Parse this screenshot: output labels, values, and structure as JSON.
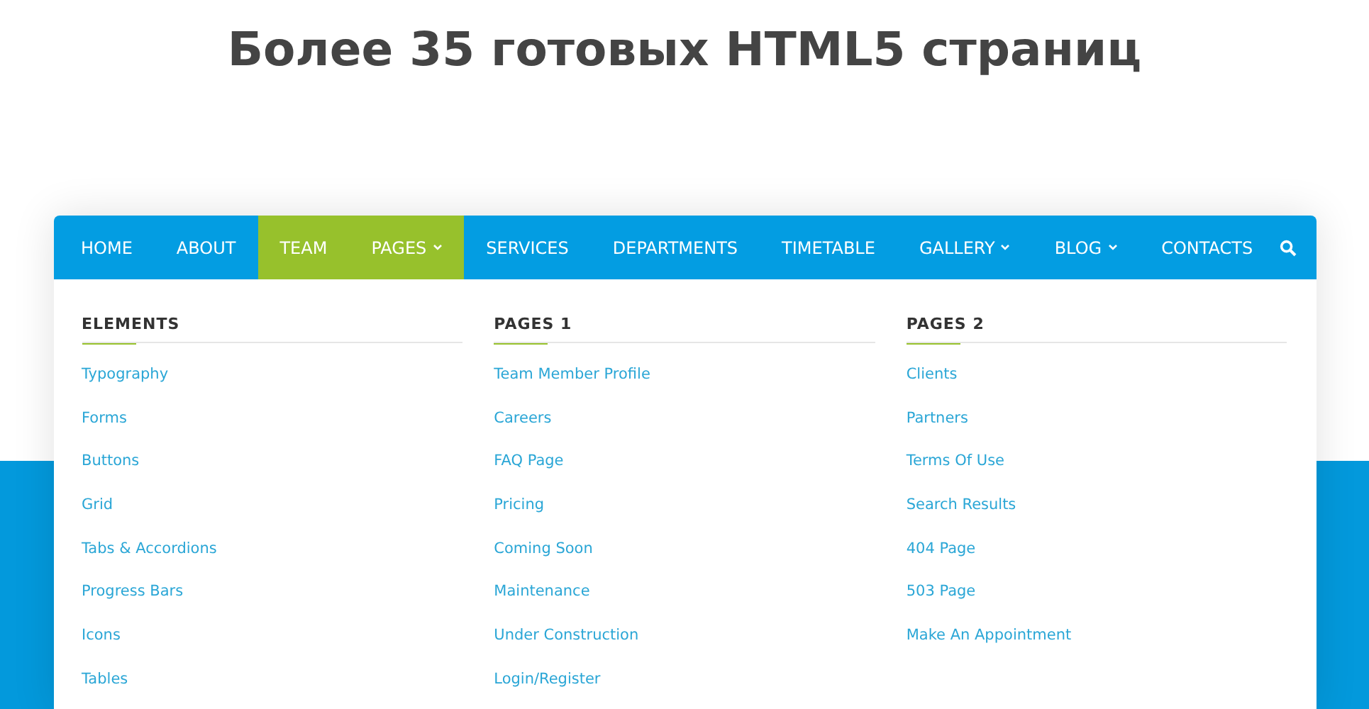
{
  "title": "Более 35 готовых HTML5 страниц",
  "nav": [
    {
      "label": "HOME",
      "highlighted": false,
      "has_dropdown": false
    },
    {
      "label": "ABOUT",
      "highlighted": false,
      "has_dropdown": false
    },
    {
      "label": "TEAM",
      "highlighted": true,
      "has_dropdown": false
    },
    {
      "label": "PAGES",
      "highlighted": true,
      "has_dropdown": true
    },
    {
      "label": "SERVICES",
      "highlighted": false,
      "has_dropdown": false
    },
    {
      "label": "DEPARTMENTS",
      "highlighted": false,
      "has_dropdown": false
    },
    {
      "label": "TIMETABLE",
      "highlighted": false,
      "has_dropdown": false
    },
    {
      "label": "GALLERY",
      "highlighted": false,
      "has_dropdown": true
    },
    {
      "label": "BLOG",
      "highlighted": false,
      "has_dropdown": true
    },
    {
      "label": "CONTACTS",
      "highlighted": false,
      "has_dropdown": false
    }
  ],
  "menu_columns": [
    {
      "heading": "ELEMENTS",
      "links": [
        "Typography",
        "Forms",
        "Buttons",
        "Grid",
        "Tabs & Accordions",
        "Progress Bars",
        "Icons",
        "Tables"
      ]
    },
    {
      "heading": "PAGES 1",
      "links": [
        "Team Member Profile",
        "Careers",
        "FAQ Page",
        "Pricing",
        "Coming Soon",
        "Maintenance",
        "Under Construction",
        "Login/Register"
      ]
    },
    {
      "heading": "PAGES 2",
      "links": [
        "Clients",
        "Partners",
        "Terms Of Use",
        "Search Results",
        "404 Page",
        "503 Page",
        "Make An Appointment"
      ]
    }
  ]
}
